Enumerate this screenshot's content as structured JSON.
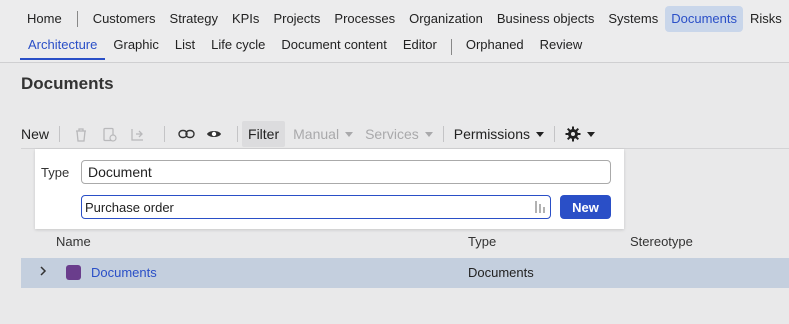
{
  "nav": {
    "primary": [
      {
        "label": "Home"
      },
      {
        "label": "Customers"
      },
      {
        "label": "Strategy"
      },
      {
        "label": "KPIs"
      },
      {
        "label": "Projects"
      },
      {
        "label": "Processes"
      },
      {
        "label": "Organization"
      },
      {
        "label": "Business objects"
      },
      {
        "label": "Systems"
      },
      {
        "label": "Documents",
        "active": true
      },
      {
        "label": "Risks"
      }
    ],
    "secondary": [
      {
        "label": "Architecture",
        "active": true
      },
      {
        "label": "Graphic"
      },
      {
        "label": "List"
      },
      {
        "label": "Life cycle"
      },
      {
        "label": "Document content"
      },
      {
        "label": "Editor"
      },
      {
        "label": "Orphaned"
      },
      {
        "label": "Review"
      }
    ]
  },
  "page": {
    "title": "Documents"
  },
  "toolbar": {
    "new_label": "New",
    "filter_label": "Filter",
    "manual_label": "Manual",
    "services_label": "Services",
    "permissions_label": "Permissions",
    "icons": [
      "trash-icon",
      "copy-icon",
      "move-icon",
      "link-icon",
      "eye-icon",
      "gear-icon"
    ]
  },
  "filter_popup": {
    "type_label": "Type",
    "type_value": "Document",
    "search_value": "Purchase order",
    "new_button": "New"
  },
  "table": {
    "columns": [
      "Name",
      "Type",
      "Stereotype"
    ],
    "rows": [
      {
        "name": "Documents",
        "type": "Documents",
        "stereotype": "",
        "color": "#6a3d8c"
      }
    ]
  },
  "colors": {
    "accent": "#2a4fc7",
    "selected_row": "#c4cfde",
    "active_tab_bg": "#c9d6ea"
  }
}
